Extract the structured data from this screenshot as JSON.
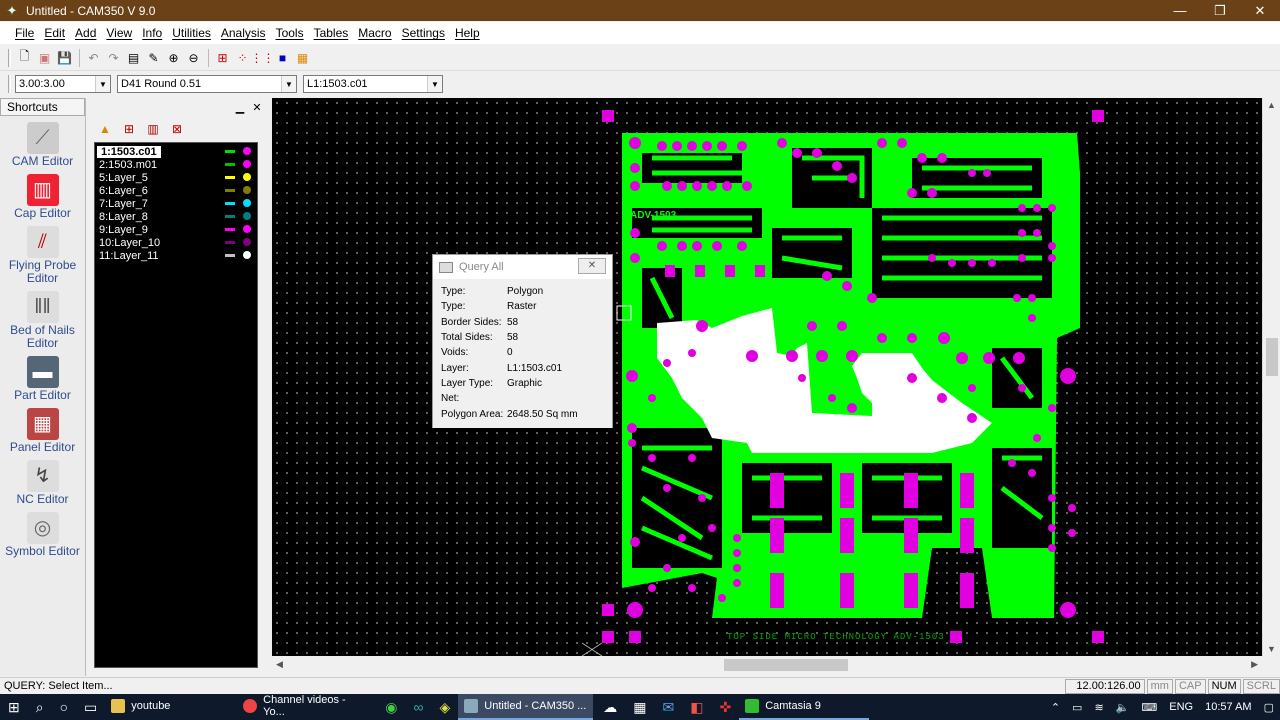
{
  "window": {
    "title": "Untitled - CAM350 V 9.0",
    "controls": [
      "—",
      "❐",
      "✕"
    ]
  },
  "menu": [
    "File",
    "Edit",
    "Add",
    "View",
    "Info",
    "Utilities",
    "Analysis",
    "Tools",
    "Tables",
    "Macro",
    "Settings",
    "Help"
  ],
  "combos": {
    "scale": "3.00:3.00",
    "aperture": "D41   Round 0.51",
    "layer": "L1:1503.c01"
  },
  "shortcuts": {
    "title": "Shortcuts",
    "items": [
      "CAM Editor",
      "Cap Editor",
      "Flying Probe Editor",
      "Bed of Nails Editor",
      "Part Editor",
      "Panel Editor",
      "NC Editor",
      "Symbol Editor"
    ]
  },
  "layers": [
    {
      "name": "1:1503.c01",
      "color": "#00e000",
      "dot": "#ff00ff",
      "active": true
    },
    {
      "name": "2:1503.m01",
      "color": "#00c000",
      "dot": "#ff00ff"
    },
    {
      "name": "5:Layer_5",
      "color": "#ffff00",
      "dot": "#ffff00"
    },
    {
      "name": "6:Layer_6",
      "color": "#808000",
      "dot": "#808000"
    },
    {
      "name": "7:Layer_7",
      "color": "#00e0ff",
      "dot": "#00e0ff"
    },
    {
      "name": "8:Layer_8",
      "color": "#008080",
      "dot": "#008080"
    },
    {
      "name": "9:Layer_9",
      "color": "#ff00ff",
      "dot": "#ff00ff"
    },
    {
      "name": "10:Layer_10",
      "color": "#800080",
      "dot": "#800080"
    },
    {
      "name": "11:Layer_11",
      "color": "#c0c0c0",
      "dot": "#ffffff"
    }
  ],
  "query": {
    "title": "Query All",
    "close": "✕",
    "rows": [
      {
        "k": "Type:",
        "v": "Polygon"
      },
      {
        "k": "Type:",
        "v": "Raster"
      },
      {
        "k": "Border Sides:",
        "v": "58"
      },
      {
        "k": "Total Sides:",
        "v": "58"
      },
      {
        "k": "Voids:",
        "v": "0"
      },
      {
        "k": "Layer:",
        "v": "L1:1503.c01"
      },
      {
        "k": "Layer Type:",
        "v": "Graphic"
      },
      {
        "k": "Net:",
        "v": ""
      },
      {
        "k": "Polygon Area:",
        "v": "2648.50 Sq mm"
      }
    ]
  },
  "board": {
    "label": "ADV-1503",
    "footer": "TOP SIDE MICRO TECHNOLOGY ADV-1503"
  },
  "status": {
    "message": "QUERY: Select Item...",
    "coords": "12.00:126.00",
    "units": "mm",
    "cap": "CAP",
    "num": "NUM",
    "scrl": "SCRL"
  },
  "taskbar": {
    "apps": [
      "youtube",
      "Channel videos - Yo...",
      "Untitled - CAM350 ...",
      "Camtasia 9"
    ],
    "lang": "ENG",
    "time": "10:57 AM"
  },
  "colors": {
    "titlebar": "#6b4217",
    "copper": "#00ff00",
    "pad": "#e000e0",
    "taskbar": "#0e1a2b"
  }
}
